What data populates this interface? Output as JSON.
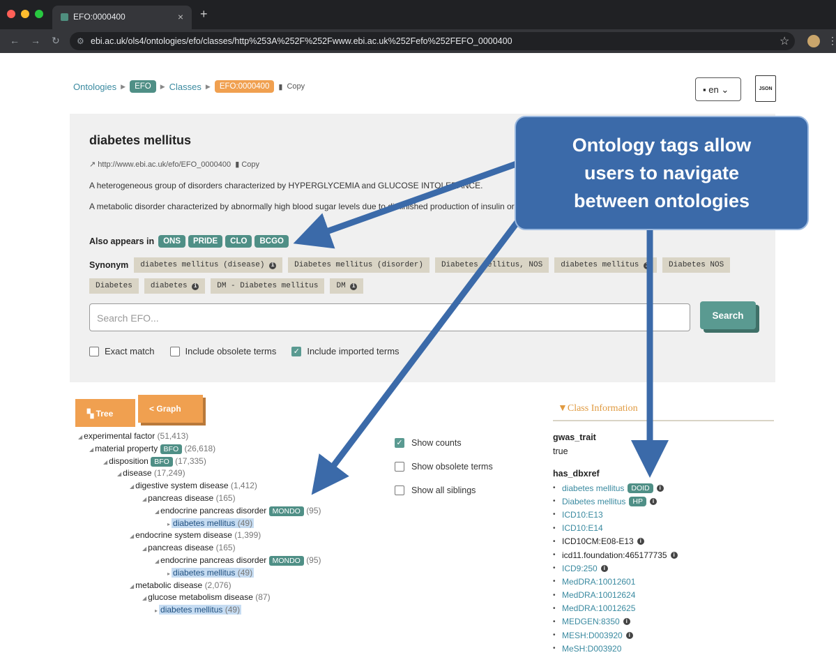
{
  "browser": {
    "tab_title": "EFO:0000400",
    "url": "ebi.ac.uk/ols4/ontologies/efo/classes/http%253A%252F%252Fwww.ebi.ac.uk%252Fefo%252FEFO_0000400"
  },
  "breadcrumb": {
    "ontologies": "Ontologies",
    "efo": "EFO",
    "classes": "Classes",
    "current": "EFO:0000400",
    "copy": "Copy"
  },
  "header": {
    "lang": "en",
    "json": "JSON"
  },
  "term": {
    "title": "diabetes mellitus",
    "iri": "http://www.ebi.ac.uk/efo/EFO_0000400",
    "iri_copy": "Copy",
    "desc1": "A heterogeneous group of disorders characterized by HYPERGLYCEMIA and GLUCOSE INTOLERANCE.",
    "desc2": "A metabolic disorder characterized by abnormally high blood sugar levels due to diminished production of insulin or insulin resistance/desensitization.",
    "also_label": "Also appears in",
    "also": [
      "ONS",
      "PRIDE",
      "CLO",
      "BCGO"
    ],
    "synonym_label": "Synonym",
    "synonyms": [
      "diabetes mellitus (disease)",
      "Diabetes mellitus (disorder)",
      "Diabetes mellitus, NOS",
      "diabetes mellitus",
      "Diabetes NOS",
      "Diabetes",
      "diabetes",
      "DM - Diabetes mellitus",
      "DM"
    ]
  },
  "search": {
    "placeholder": "Search EFO...",
    "button": "Search",
    "exact": "Exact match",
    "obsolete": "Include obsolete terms",
    "imported": "Include imported terms"
  },
  "view": {
    "tree": "Tree",
    "graph": "Graph"
  },
  "tree": [
    {
      "label": "experimental factor",
      "count": "(51,413)"
    },
    {
      "label": "material property",
      "tag": "BFO",
      "count": "(26,618)"
    },
    {
      "label": "disposition",
      "tag": "BFO",
      "count": "(17,335)"
    },
    {
      "label": "disease",
      "count": "(17,249)"
    },
    {
      "label": "digestive system disease",
      "count": "(1,412)"
    },
    {
      "label": "pancreas disease",
      "count": "(165)"
    },
    {
      "label": "endocrine pancreas disorder",
      "tag": "MONDO",
      "count": "(95)"
    },
    {
      "label": "diabetes mellitus",
      "count": "(49)",
      "hl": true
    },
    {
      "label": "endocrine system disease",
      "count": "(1,399)"
    },
    {
      "label": "pancreas disease",
      "count": "(165)"
    },
    {
      "label": "endocrine pancreas disorder",
      "tag": "MONDO",
      "count": "(95)"
    },
    {
      "label": "diabetes mellitus",
      "count": "(49)",
      "hl": true
    },
    {
      "label": "metabolic disease",
      "count": "(2,076)"
    },
    {
      "label": "glucose metabolism disease",
      "count": "(87)"
    },
    {
      "label": "diabetes mellitus",
      "count": "(49)",
      "hl": true
    }
  ],
  "toggles": {
    "counts": "Show counts",
    "obsolete": "Show obsolete terms",
    "siblings": "Show all siblings"
  },
  "class_info": {
    "heading": "Class Information",
    "gwas_label": "gwas_trait",
    "gwas_value": "true",
    "dbxref_label": "has_dbxref",
    "xrefs": [
      {
        "text": "diabetes mellitus",
        "tag": "DOID",
        "info": true,
        "link": true
      },
      {
        "text": "Diabetes mellitus",
        "tag": "HP",
        "info": true,
        "link": true
      },
      {
        "text": "ICD10:E13",
        "link": true
      },
      {
        "text": "ICD10:E14",
        "link": true
      },
      {
        "text": "ICD10CM:E08-E13",
        "info": true,
        "link": false
      },
      {
        "text": "icd11.foundation:465177735",
        "info": true,
        "link": false
      },
      {
        "text": "ICD9:250",
        "info": true,
        "link": true
      },
      {
        "text": "MedDRA:10012601",
        "link": true
      },
      {
        "text": "MedDRA:10012624",
        "link": true
      },
      {
        "text": "MedDRA:10012625",
        "link": true
      },
      {
        "text": "MEDGEN:8350",
        "info": true,
        "link": true
      },
      {
        "text": "MESH:D003920",
        "info": true,
        "link": true
      },
      {
        "text": "MeSH:D003920",
        "link": true
      }
    ]
  },
  "callout": {
    "line1": "Ontology tags allow",
    "line2": "users to navigate",
    "line3": "between ontologies"
  },
  "colors": {
    "teal": "#4f8f86",
    "orange": "#f0a050",
    "callout": "#3b6aa9",
    "highlight": "#c6dcf2"
  }
}
